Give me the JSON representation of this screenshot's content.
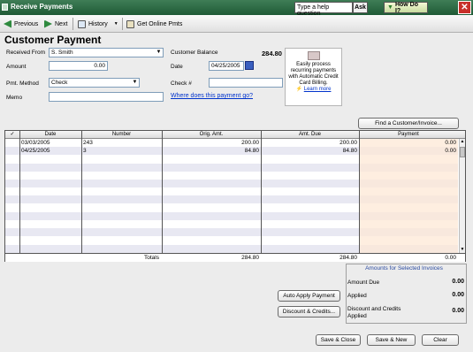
{
  "window": {
    "title": "Receive Payments",
    "help_placeholder": "Type a help question",
    "ask": "Ask",
    "how_do_i": "How Do I?",
    "close": "✕"
  },
  "toolbar": {
    "previous": "Previous",
    "next": "Next",
    "history": "History",
    "get_online": "Get Online Pmts"
  },
  "form": {
    "heading": "Customer Payment",
    "received_from_label": "Received From",
    "received_from_value": "S. Smith",
    "amount_label": "Amount",
    "amount_value": "0.00",
    "pmt_method_label": "Pmt. Method",
    "pmt_method_value": "Check",
    "memo_label": "Memo",
    "memo_value": "",
    "customer_balance_label": "Customer Balance",
    "customer_balance_value": "284.80",
    "date_label": "Date",
    "date_value": "04/25/2005",
    "check_label": "Check #",
    "check_value": "",
    "where_link": "Where does this payment go?"
  },
  "ad": {
    "text": "Easily process recurring payments with Automatic Credit Card Billing.",
    "learn_more": "Learn more"
  },
  "find_button": "Find a Customer/Invoice...",
  "table": {
    "columns": [
      "✓",
      "Date",
      "Number",
      "Orig. Amt.",
      "Amt. Due",
      "Payment"
    ],
    "rows": [
      {
        "check": "",
        "date": "03/03/2005",
        "number": "243",
        "orig": "200.00",
        "due": "200.00",
        "payment": "0.00"
      },
      {
        "check": "",
        "date": "04/25/2005",
        "number": "3",
        "orig": "84.80",
        "due": "84.80",
        "payment": "0.00"
      }
    ],
    "totals": {
      "label": "Totals",
      "orig": "284.80",
      "due": "284.80",
      "payment": "0.00"
    }
  },
  "amounts": {
    "title": "Amounts for Selected Invoices",
    "due_label": "Amount Due",
    "due_value": "0.00",
    "applied_label": "Applied",
    "applied_value": "0.00",
    "disc_label": "Discount and Credits Applied",
    "disc_value": "0.00"
  },
  "buttons": {
    "auto_apply": "Auto Apply Payment",
    "discount": "Discount & Credits...",
    "save_close": "Save & Close",
    "save_new": "Save & New",
    "clear": "Clear"
  },
  "colors": {
    "titlebar": "#2c6b45",
    "payment_col": "#fdf0e6",
    "alt_row": "#e8e8f2",
    "link": "#0033cc"
  }
}
